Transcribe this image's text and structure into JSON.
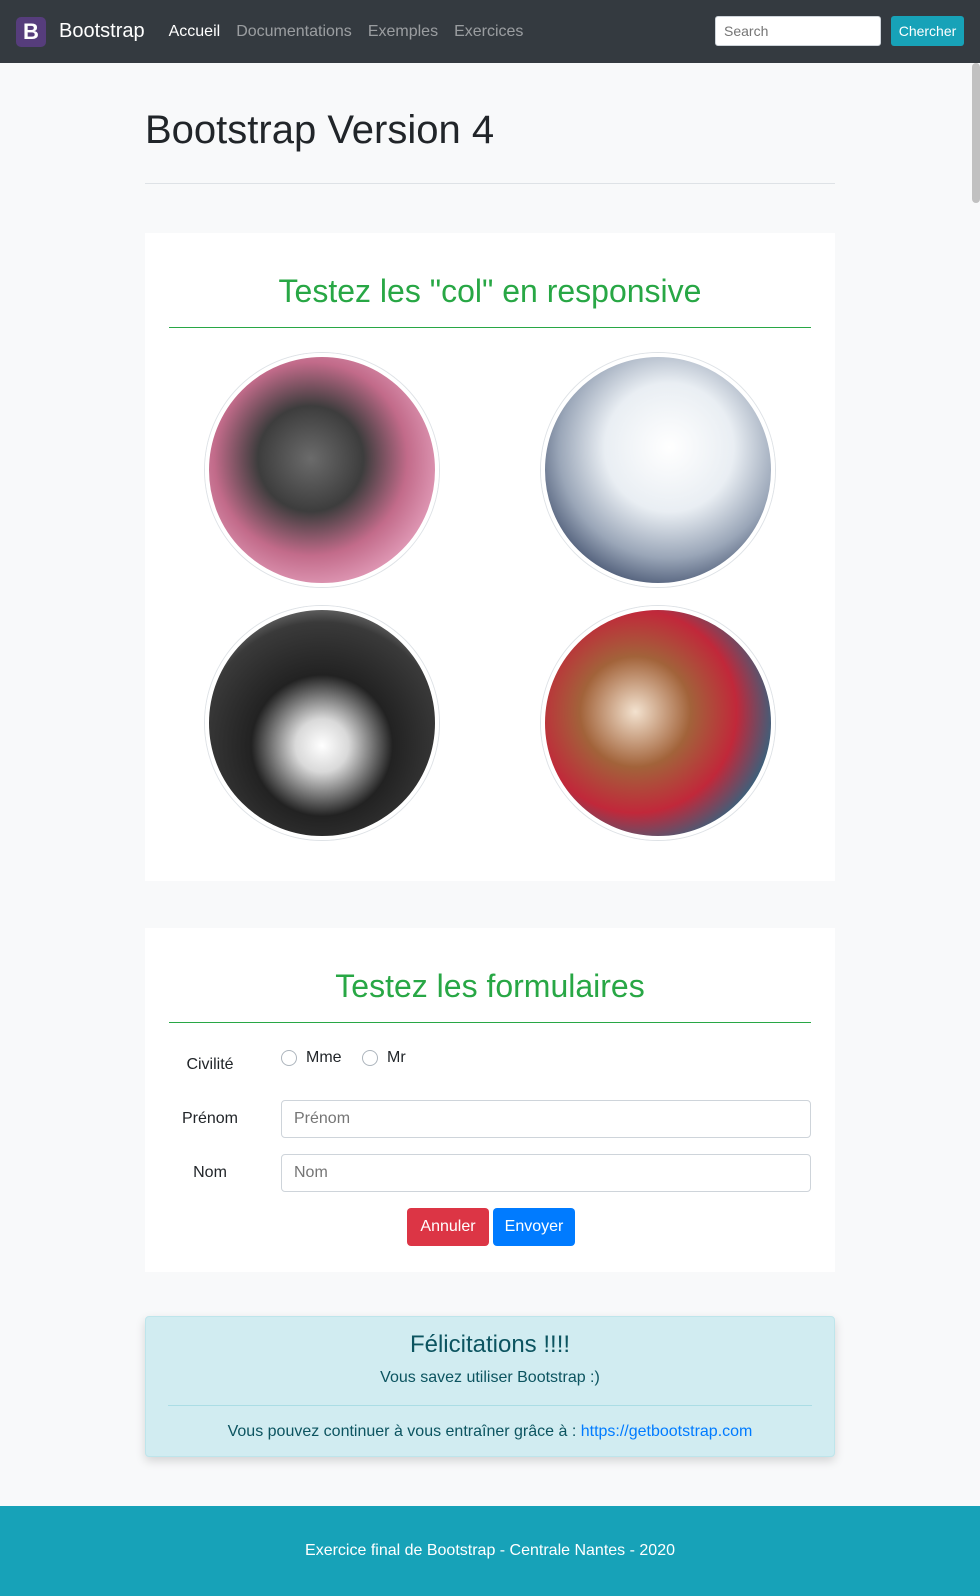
{
  "navbar": {
    "brand_logo": "B",
    "brand": "Bootstrap",
    "links": [
      "Accueil",
      "Documentations",
      "Exemples",
      "Exercices"
    ],
    "search_placeholder": "Search",
    "search_button": "Chercher"
  },
  "page": {
    "title": "Bootstrap Version 4"
  },
  "gallery": {
    "heading": "Testez les \"col\" en responsive",
    "images": [
      "tabby-kitten",
      "white-kitten",
      "black-white-kitten",
      "calico-kitten"
    ]
  },
  "form": {
    "heading": "Testez les formulaires",
    "civility_label": "Civilité",
    "radio_options": [
      "Mme",
      "Mr"
    ],
    "firstname_label": "Prénom",
    "firstname_placeholder": "Prénom",
    "lastname_label": "Nom",
    "lastname_placeholder": "Nom",
    "cancel_button": "Annuler",
    "submit_button": "Envoyer"
  },
  "alert": {
    "title": "Félicitations !!!!",
    "subtitle": "Vous savez utiliser Bootstrap :)",
    "text": "Vous pouvez continuer à vous entraîner grâce à : ",
    "link": "https://getbootstrap.com"
  },
  "footer": {
    "text": "Exercice final de Bootstrap - Centrale Nantes - 2020"
  },
  "colors": {
    "navbar": "#343a40",
    "info": "#17a2b8",
    "success": "#28a745",
    "danger": "#dc3545",
    "primary": "#007bff",
    "brand": "#563d7c"
  }
}
